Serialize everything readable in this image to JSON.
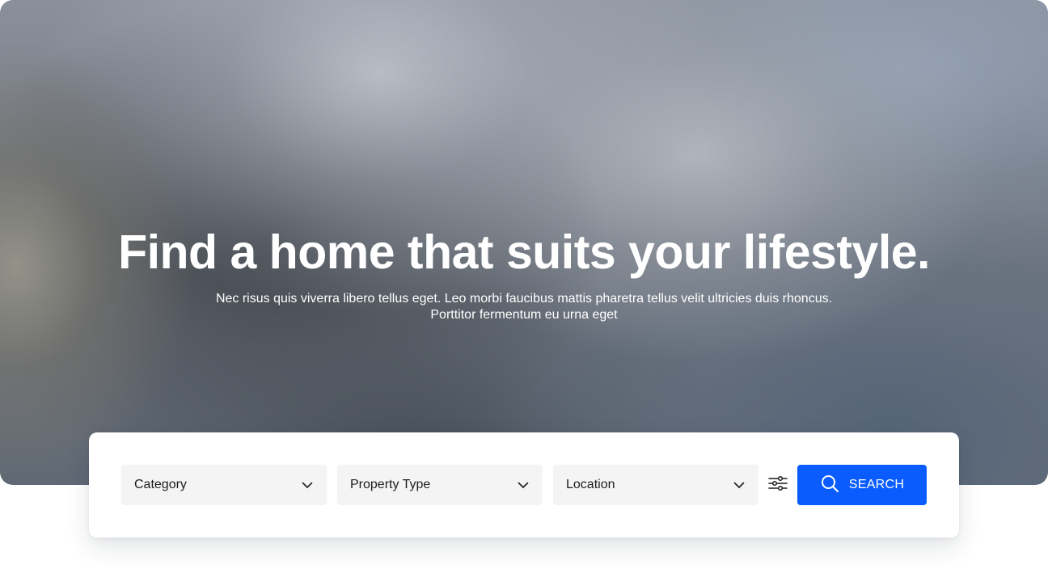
{
  "hero": {
    "title": "Find a home that suits your lifestyle.",
    "subtitle": "Nec risus quis viverra libero tellus eget. Leo morbi faucibus mattis pharetra tellus velit ultricies duis rhoncus. Porttitor fermentum eu urna eget"
  },
  "search": {
    "fields": [
      {
        "label": "Category",
        "icon": "chevron-down-icon"
      },
      {
        "label": "Property Type",
        "icon": "chevron-down-icon"
      },
      {
        "label": "Location",
        "icon": "chevron-down-icon"
      }
    ],
    "filter_icon": "sliders-icon",
    "button": {
      "label": "SEARCH",
      "icon": "search-icon"
    }
  },
  "colors": {
    "accent": "#0a5cff",
    "field_background": "#f4f4f4",
    "text_primary": "#1c1c1c"
  }
}
